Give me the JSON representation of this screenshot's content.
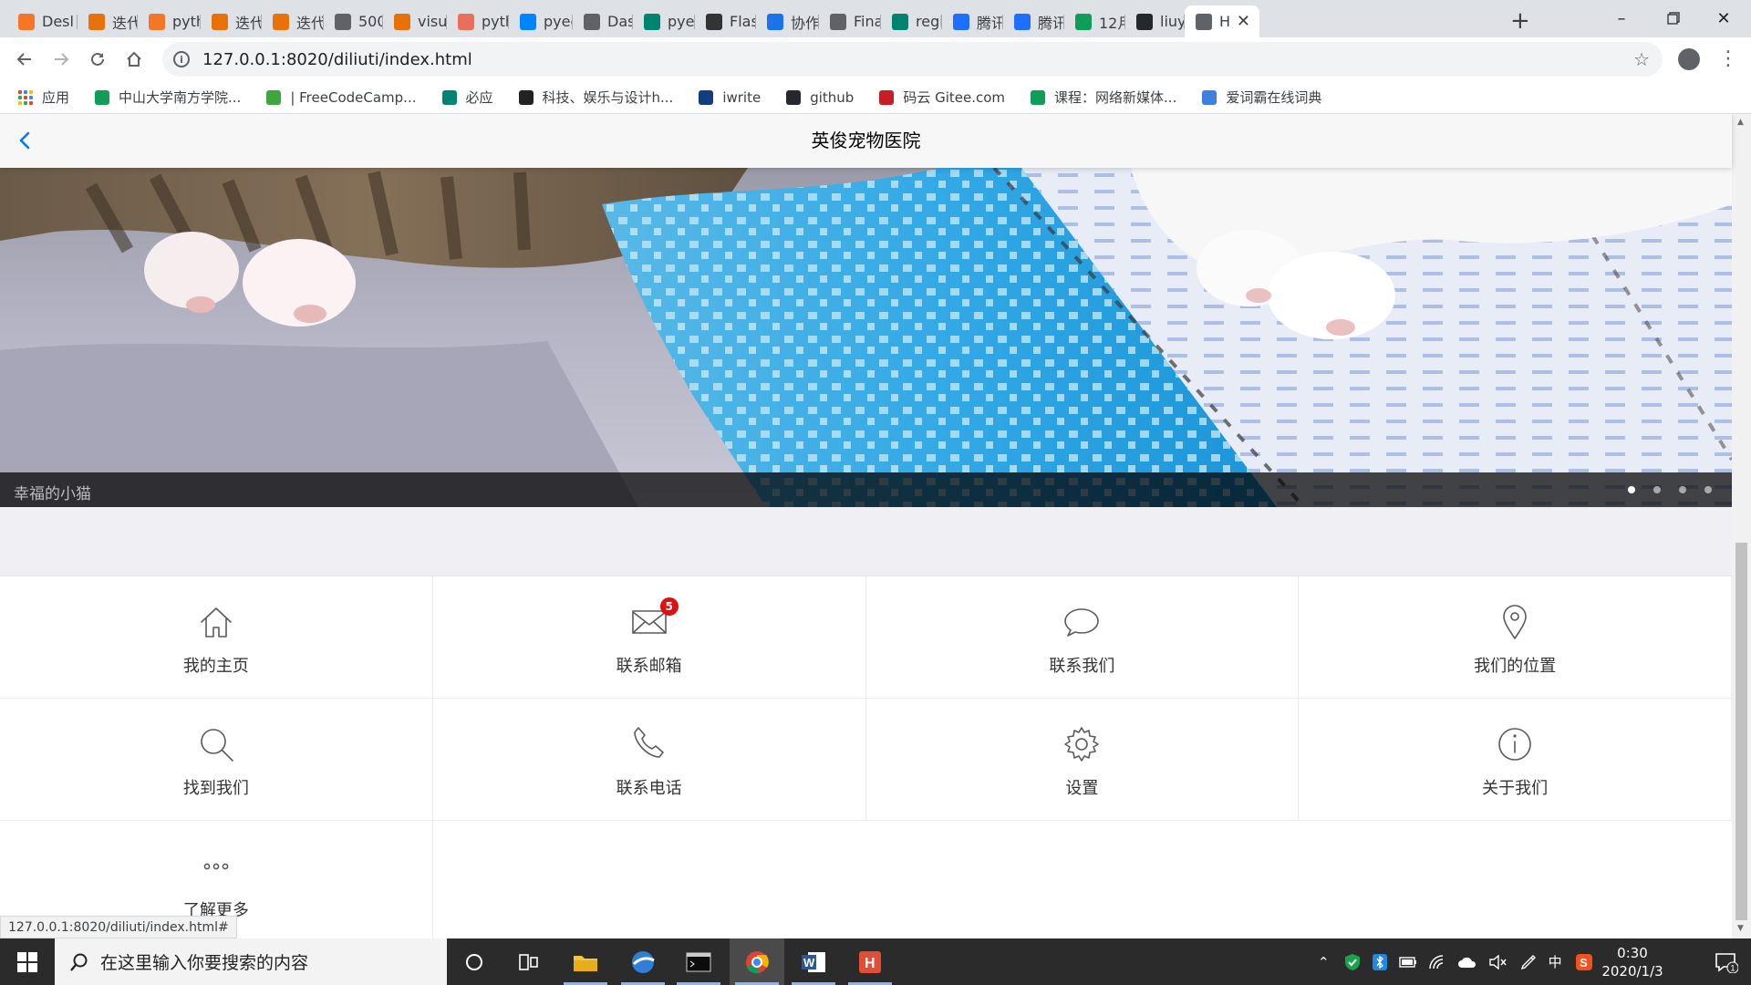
{
  "browser": {
    "tabs": [
      {
        "label": "Desl",
        "icon": "jupyter-icon",
        "color": "#f37726"
      },
      {
        "label": "迭代",
        "icon": "note-icon",
        "color": "#e8710a"
      },
      {
        "label": "pyth",
        "icon": "jupyter-icon",
        "color": "#f37726"
      },
      {
        "label": "迭代",
        "icon": "note-icon",
        "color": "#e8710a"
      },
      {
        "label": "迭代",
        "icon": "hourglass-icon",
        "color": "#e8710a"
      },
      {
        "label": "500",
        "icon": "globe-icon",
        "color": "#5f6368"
      },
      {
        "label": "visu",
        "icon": "note-icon",
        "color": "#e8710a"
      },
      {
        "label": "pyth",
        "icon": "jianshu-icon",
        "color": "#ea6f5a"
      },
      {
        "label": "pyec",
        "icon": "zhihu-icon",
        "color": "#0084ff"
      },
      {
        "label": "Dasl",
        "icon": "dash-icon",
        "color": "#5f6368"
      },
      {
        "label": "pyec",
        "icon": "bing-icon",
        "color": "#008373"
      },
      {
        "label": "Flasl",
        "icon": "flask-icon",
        "color": "#333333"
      },
      {
        "label": "协作",
        "icon": "doc-icon",
        "color": "#1a73e8"
      },
      {
        "label": "Fina",
        "icon": "globe-icon",
        "color": "#5f6368"
      },
      {
        "label": "regi",
        "icon": "bing-icon",
        "color": "#008373"
      },
      {
        "label": "腾讯",
        "icon": "tencent-doc-icon",
        "color": "#1e6fff"
      },
      {
        "label": "腾讯",
        "icon": "tencent-doc-icon",
        "color": "#1e6fff"
      },
      {
        "label": "12月",
        "icon": "sheet-icon",
        "color": "#0f9d58"
      },
      {
        "label": "liuyu",
        "icon": "github-icon",
        "color": "#24292e"
      },
      {
        "label": "H",
        "icon": "globe-icon",
        "color": "#5f6368",
        "active": true
      }
    ],
    "url": "127.0.0.1:8020/diliuti/index.html",
    "bookmarks": [
      {
        "label": "应用",
        "icon": "apps-grid-icon"
      },
      {
        "label": "中山大学南方学院...",
        "icon": "school-icon",
        "color": "#0f9d58"
      },
      {
        "label": "| FreeCodeCamp...",
        "icon": "freecodecamp-icon",
        "color": "#3da63d"
      },
      {
        "label": "必应",
        "icon": "bing-icon",
        "color": "#008373"
      },
      {
        "label": "科技、娱乐与设计h...",
        "icon": "ted-owl-icon",
        "color": "#222222"
      },
      {
        "label": "iwrite",
        "icon": "iwrite-icon",
        "color": "#123e80"
      },
      {
        "label": "github",
        "icon": "github-icon",
        "color": "#24292e"
      },
      {
        "label": "码云 Gitee.com",
        "icon": "gitee-icon",
        "color": "#c71d23"
      },
      {
        "label": "课程：网络新媒体...",
        "icon": "school-icon",
        "color": "#0f9d58"
      },
      {
        "label": "爱词霸在线词典",
        "icon": "iciba-icon",
        "color": "#3f7fe0"
      }
    ],
    "status_url": "127.0.0.1:8020/diliuti/index.html#"
  },
  "app": {
    "title": "英俊宠物医院",
    "slider": {
      "caption": "幸福的小猫",
      "dot_count": 4,
      "active_dot": 0
    },
    "grid": [
      {
        "label": "我的主页",
        "icon": "home-icon"
      },
      {
        "label": "联系邮箱",
        "icon": "email-icon",
        "badge": "5"
      },
      {
        "label": "联系我们",
        "icon": "chat-icon"
      },
      {
        "label": "我们的位置",
        "icon": "location-icon"
      },
      {
        "label": "找到我们",
        "icon": "search-icon"
      },
      {
        "label": "联系电话",
        "icon": "phone-icon"
      },
      {
        "label": "设置",
        "icon": "gear-icon"
      },
      {
        "label": "关于我们",
        "icon": "info-icon"
      },
      {
        "label": "了解更多",
        "icon": "more-icon"
      }
    ]
  },
  "taskbar": {
    "search_placeholder": "在这里输入你要搜索的内容",
    "apps": [
      "cortana-icon",
      "task-view-icon",
      "file-explorer-icon",
      "browser-icon",
      "terminal-icon",
      "chrome-icon",
      "word-icon",
      "hbuilder-icon"
    ],
    "ime": "中",
    "time": "0:30",
    "date": "2020/1/3",
    "notification_count": "1"
  }
}
